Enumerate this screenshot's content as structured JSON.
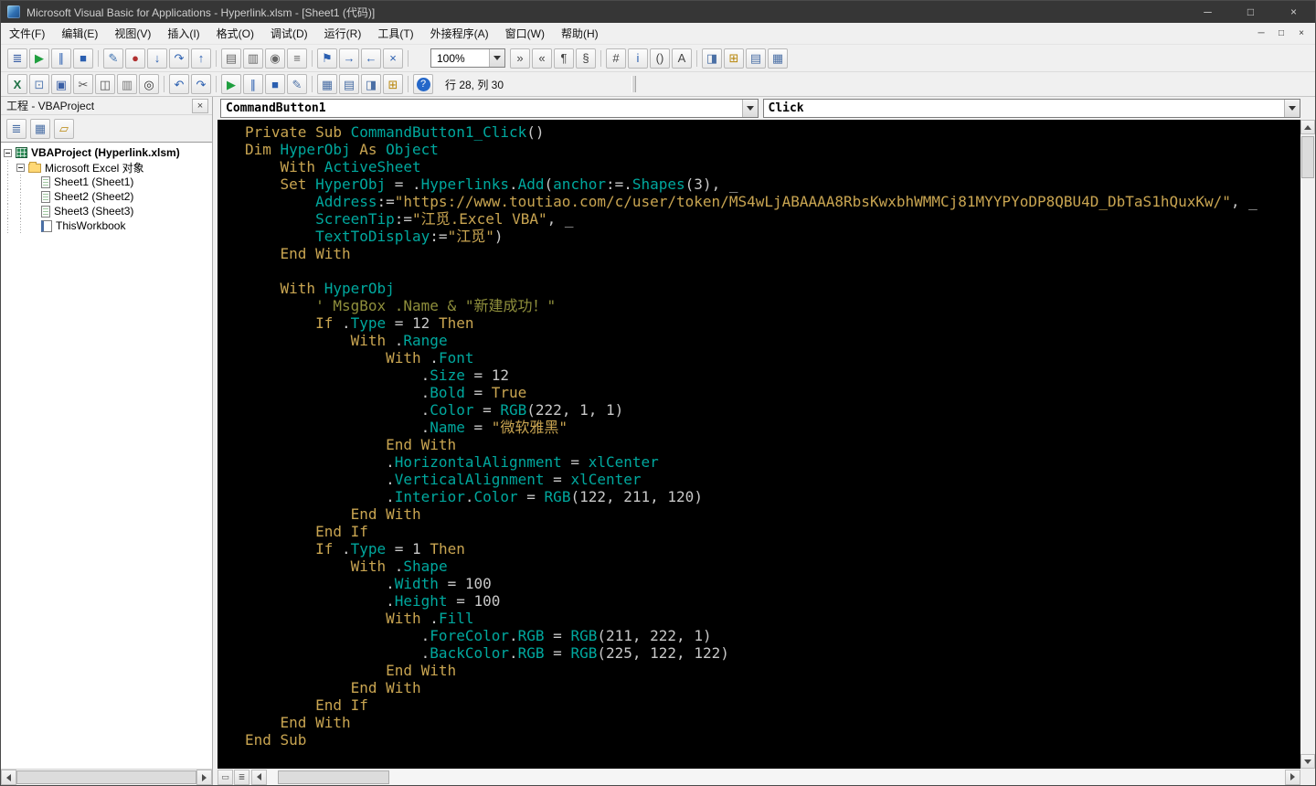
{
  "colors": {
    "keyword": "#c9a551",
    "identifier": "#00a89e",
    "string": "#c9a551",
    "normal": "#c8c8c8",
    "comment": "#8f8f3c",
    "code_bg": "#000000",
    "titlebar_bg": "#363636",
    "chrome_bg": "#f0f0f0"
  },
  "window": {
    "title": "Microsoft Visual Basic for Applications - Hyperlink.xlsm - [Sheet1 (代码)]",
    "controls": {
      "minimize": "─",
      "maximize": "□",
      "close": "×"
    }
  },
  "menu": {
    "items": [
      {
        "name": "file",
        "label": "文件(F)"
      },
      {
        "name": "edit",
        "label": "编辑(E)"
      },
      {
        "name": "view",
        "label": "视图(V)"
      },
      {
        "name": "insert",
        "label": "插入(I)"
      },
      {
        "name": "format",
        "label": "格式(O)"
      },
      {
        "name": "debug",
        "label": "调试(D)"
      },
      {
        "name": "run",
        "label": "运行(R)"
      },
      {
        "name": "tools",
        "label": "工具(T)"
      },
      {
        "name": "addins",
        "label": "外接程序(A)"
      },
      {
        "name": "window",
        "label": "窗口(W)"
      },
      {
        "name": "help",
        "label": "帮助(H)"
      }
    ],
    "child_controls": {
      "minimize": "─",
      "restore": "□",
      "close": "×"
    }
  },
  "toolbar_edit_debug": {
    "zoom_value": "100%",
    "buttons_left": [
      {
        "name": "list-properties-button",
        "glyph": "≣",
        "color": "#3a5fa5"
      },
      {
        "name": "run-sub-button",
        "glyph": "▶",
        "color": "#1e9e3e"
      },
      {
        "name": "break-button",
        "glyph": "∥",
        "color": "#2b5fb0"
      },
      {
        "name": "reset-button",
        "glyph": "■",
        "color": "#2b5fb0"
      },
      {
        "sep": true
      },
      {
        "name": "design-mode-button",
        "glyph": "✎",
        "color": "#3a6fae"
      },
      {
        "name": "toggle-breakpoint-button",
        "glyph": "●",
        "color": "#b03030"
      },
      {
        "name": "step-into-button",
        "glyph": "↓",
        "color": "#2b5fb0"
      },
      {
        "name": "step-over-button",
        "glyph": "↷",
        "color": "#2b5fb0"
      },
      {
        "name": "step-out-button",
        "glyph": "↑",
        "color": "#2b5fb0"
      },
      {
        "sep": true
      },
      {
        "name": "locals-window-button",
        "glyph": "▤",
        "color": "#666666"
      },
      {
        "name": "immediate-window-button",
        "glyph": "▥",
        "color": "#666666"
      },
      {
        "name": "watch-window-button",
        "glyph": "◉",
        "color": "#666666"
      },
      {
        "name": "call-stack-button",
        "glyph": "≡",
        "color": "#666666"
      },
      {
        "sep": true
      },
      {
        "name": "toggle-bookmark-button",
        "glyph": "⚑",
        "color": "#2b5fb0"
      },
      {
        "name": "next-bookmark-button",
        "glyph": "→",
        "color": "#2b5fb0"
      },
      {
        "name": "previous-bookmark-button",
        "glyph": "←",
        "color": "#2b5fb0"
      },
      {
        "name": "clear-bookmarks-button",
        "glyph": "×",
        "color": "#2b5fb0"
      },
      {
        "sep": true
      }
    ],
    "buttons_right": [
      {
        "name": "indent-button",
        "glyph": "»",
        "color": "#444444"
      },
      {
        "name": "outdent-button",
        "glyph": "«",
        "color": "#444444"
      },
      {
        "name": "comment-block-button",
        "glyph": "¶",
        "color": "#444444"
      },
      {
        "name": "uncomment-block-button",
        "glyph": "§",
        "color": "#444444"
      },
      {
        "sep": true
      },
      {
        "name": "list-constants-button",
        "glyph": "#",
        "color": "#444444"
      },
      {
        "name": "quick-info-button",
        "glyph": "i",
        "color": "#2b5fb0"
      },
      {
        "name": "parameter-info-button",
        "glyph": "()",
        "color": "#444444"
      },
      {
        "name": "complete-word-button",
        "glyph": "A",
        "color": "#444444"
      },
      {
        "sep": true
      },
      {
        "name": "object-browser-top-button",
        "glyph": "◨",
        "color": "#4a6fa5"
      },
      {
        "name": "toolbox-top-button",
        "glyph": "⊞",
        "color": "#b8860b"
      },
      {
        "name": "properties-top-button",
        "glyph": "▤",
        "color": "#4a6fa5"
      },
      {
        "name": "project-top-button",
        "glyph": "▦",
        "color": "#4a6fa5"
      }
    ]
  },
  "toolbar_standard": {
    "position_text": "行 28, 列 30",
    "buttons": [
      {
        "name": "view-excel-button",
        "glyph": "X",
        "color": "#1e7145"
      },
      {
        "name": "insert-userform-button",
        "glyph": "⊡",
        "color": "#5b7fb4"
      },
      {
        "name": "save-button",
        "glyph": "▣",
        "color": "#3a5fa5"
      },
      {
        "name": "cut-button",
        "glyph": "✂",
        "color": "#555555"
      },
      {
        "name": "copy-button",
        "glyph": "◫",
        "color": "#555555"
      },
      {
        "name": "paste-button",
        "glyph": "▥",
        "color": "#777777"
      },
      {
        "name": "find-button",
        "glyph": "◎",
        "color": "#333333"
      },
      {
        "sep": true
      },
      {
        "name": "undo-button",
        "glyph": "↶",
        "color": "#2b5fb0"
      },
      {
        "name": "redo-button",
        "glyph": "↷",
        "color": "#2b5fb0"
      },
      {
        "sep": true
      },
      {
        "name": "run-button",
        "glyph": "▶",
        "color": "#1e9e3e"
      },
      {
        "name": "break-std-button",
        "glyph": "∥",
        "color": "#2b5fb0"
      },
      {
        "name": "reset-std-button",
        "glyph": "■",
        "color": "#2b5fb0"
      },
      {
        "name": "design-mode-std-button",
        "glyph": "✎",
        "color": "#4a6fa5"
      },
      {
        "sep": true
      },
      {
        "name": "project-explorer-button",
        "glyph": "▦",
        "color": "#4a6fa5"
      },
      {
        "name": "properties-window-button",
        "glyph": "▤",
        "color": "#4a6fa5"
      },
      {
        "name": "object-browser-button",
        "glyph": "◨",
        "color": "#4a6fa5"
      },
      {
        "name": "toolbox-button",
        "glyph": "⊞",
        "color": "#b8860b"
      },
      {
        "sep": true
      },
      {
        "name": "help-button",
        "glyph": "?",
        "color": "#ffffff"
      }
    ]
  },
  "project_panel": {
    "title": "工程 - VBAProject",
    "close_glyph": "×",
    "toolbar": [
      {
        "name": "view-code-button",
        "glyph": "≣",
        "color": "#4a6fa5"
      },
      {
        "name": "view-object-button",
        "glyph": "▦",
        "color": "#4a6fa5"
      },
      {
        "name": "toggle-folders-button",
        "glyph": "▱",
        "color": "#b8860b"
      }
    ],
    "tree": [
      {
        "id": "vbaproject",
        "level": 0,
        "expander": true,
        "icon": "excel-project",
        "label": "VBAProject (Hyperlink.xlsm)",
        "bold": true
      },
      {
        "id": "excel-objects",
        "level": 1,
        "expander": true,
        "icon": "folder",
        "label": "Microsoft Excel 对象",
        "bold": false
      },
      {
        "id": "sheet1",
        "level": 2,
        "expander": false,
        "icon": "worksheet",
        "label": "Sheet1 (Sheet1)",
        "bold": false
      },
      {
        "id": "sheet2",
        "level": 2,
        "expander": false,
        "icon": "worksheet",
        "label": "Sheet2 (Sheet2)",
        "bold": false
      },
      {
        "id": "sheet3",
        "level": 2,
        "expander": false,
        "icon": "worksheet",
        "label": "Sheet3 (Sheet3)",
        "bold": false
      },
      {
        "id": "thisworkbook",
        "level": 2,
        "expander": false,
        "icon": "workbook",
        "label": "ThisWorkbook",
        "bold": false
      }
    ]
  },
  "code_window": {
    "object_combo": "CommandButton1",
    "procedure_combo": "Click",
    "view_buttons": [
      {
        "name": "procedure-view-button",
        "glyph": "▭"
      },
      {
        "name": "full-module-view-button",
        "glyph": "≣"
      }
    ],
    "lines": [
      [
        [
          "k",
          "Private Sub "
        ],
        [
          "i",
          "CommandButton1_Click"
        ],
        [
          "n",
          "()"
        ]
      ],
      [
        [
          "k",
          "Dim "
        ],
        [
          "i",
          "HyperObj"
        ],
        [
          "k",
          " As "
        ],
        [
          "i",
          "Object"
        ]
      ],
      [
        [
          "n",
          "    "
        ],
        [
          "k",
          "With "
        ],
        [
          "i",
          "ActiveSheet"
        ]
      ],
      [
        [
          "n",
          "    "
        ],
        [
          "k",
          "Set "
        ],
        [
          "i",
          "HyperObj"
        ],
        [
          "n",
          " = ."
        ],
        [
          "i",
          "Hyperlinks"
        ],
        [
          "n",
          "."
        ],
        [
          "i",
          "Add"
        ],
        [
          "n",
          "("
        ],
        [
          "i",
          "anchor"
        ],
        [
          "n",
          ":=."
        ],
        [
          "i",
          "Shapes"
        ],
        [
          "n",
          "(3), _"
        ]
      ],
      [
        [
          "n",
          "        "
        ],
        [
          "i",
          "Address"
        ],
        [
          "n",
          ":="
        ],
        [
          "s",
          "\"https://www.toutiao.com/c/user/token/MS4wLjABAAAA8RbsKwxbhWMMCj81MYYPYoDP8QBU4D_DbTaS1hQuxKw/\""
        ],
        [
          "n",
          ", _"
        ]
      ],
      [
        [
          "n",
          "        "
        ],
        [
          "i",
          "ScreenTip"
        ],
        [
          "n",
          ":="
        ],
        [
          "s",
          "\"江觅.Excel VBA\""
        ],
        [
          "n",
          ", _"
        ]
      ],
      [
        [
          "n",
          "        "
        ],
        [
          "i",
          "TextToDisplay"
        ],
        [
          "n",
          ":="
        ],
        [
          "s",
          "\"江觅\""
        ],
        [
          "n",
          ")"
        ]
      ],
      [
        [
          "n",
          "    "
        ],
        [
          "k",
          "End With"
        ]
      ],
      [],
      [
        [
          "n",
          "    "
        ],
        [
          "k",
          "With "
        ],
        [
          "i",
          "HyperObj"
        ]
      ],
      [
        [
          "n",
          "        "
        ],
        [
          "c",
          "' MsgBox .Name & \"新建成功！\""
        ]
      ],
      [
        [
          "n",
          "        "
        ],
        [
          "k",
          "If "
        ],
        [
          "n",
          "."
        ],
        [
          "i",
          "Type"
        ],
        [
          "n",
          " = 12 "
        ],
        [
          "k",
          "Then"
        ]
      ],
      [
        [
          "n",
          "            "
        ],
        [
          "k",
          "With "
        ],
        [
          "n",
          "."
        ],
        [
          "i",
          "Range"
        ]
      ],
      [
        [
          "n",
          "                "
        ],
        [
          "k",
          "With "
        ],
        [
          "n",
          "."
        ],
        [
          "i",
          "Font"
        ]
      ],
      [
        [
          "n",
          "                    ."
        ],
        [
          "i",
          "Size"
        ],
        [
          "n",
          " = 12"
        ]
      ],
      [
        [
          "n",
          "                    ."
        ],
        [
          "i",
          "Bold"
        ],
        [
          "n",
          " = "
        ],
        [
          "k",
          "True"
        ]
      ],
      [
        [
          "n",
          "                    ."
        ],
        [
          "i",
          "Color"
        ],
        [
          "n",
          " = "
        ],
        [
          "i",
          "RGB"
        ],
        [
          "n",
          "(222, 1, 1)"
        ]
      ],
      [
        [
          "n",
          "                    ."
        ],
        [
          "i",
          "Name"
        ],
        [
          "n",
          " = "
        ],
        [
          "s",
          "\"微软雅黑\""
        ]
      ],
      [
        [
          "n",
          "                "
        ],
        [
          "k",
          "End With"
        ]
      ],
      [
        [
          "n",
          "                ."
        ],
        [
          "i",
          "HorizontalAlignment"
        ],
        [
          "n",
          " = "
        ],
        [
          "i",
          "xlCenter"
        ]
      ],
      [
        [
          "n",
          "                ."
        ],
        [
          "i",
          "VerticalAlignment"
        ],
        [
          "n",
          " = "
        ],
        [
          "i",
          "xlCenter"
        ]
      ],
      [
        [
          "n",
          "                ."
        ],
        [
          "i",
          "Interior"
        ],
        [
          "n",
          "."
        ],
        [
          "i",
          "Color"
        ],
        [
          "n",
          " = "
        ],
        [
          "i",
          "RGB"
        ],
        [
          "n",
          "(122, 211, 120)"
        ]
      ],
      [
        [
          "n",
          "            "
        ],
        [
          "k",
          "End With"
        ]
      ],
      [
        [
          "n",
          "        "
        ],
        [
          "k",
          "End If"
        ]
      ],
      [
        [
          "n",
          "        "
        ],
        [
          "k",
          "If "
        ],
        [
          "n",
          "."
        ],
        [
          "i",
          "Type"
        ],
        [
          "n",
          " = 1 "
        ],
        [
          "k",
          "Then"
        ]
      ],
      [
        [
          "n",
          "            "
        ],
        [
          "k",
          "With "
        ],
        [
          "n",
          "."
        ],
        [
          "i",
          "Shape"
        ]
      ],
      [
        [
          "n",
          "                ."
        ],
        [
          "i",
          "Width"
        ],
        [
          "n",
          " = 100"
        ]
      ],
      [
        [
          "n",
          "                ."
        ],
        [
          "i",
          "Height"
        ],
        [
          "n",
          " = 100"
        ]
      ],
      [
        [
          "n",
          "                "
        ],
        [
          "k",
          "With "
        ],
        [
          "n",
          "."
        ],
        [
          "i",
          "Fill"
        ]
      ],
      [
        [
          "n",
          "                    ."
        ],
        [
          "i",
          "ForeColor"
        ],
        [
          "n",
          "."
        ],
        [
          "i",
          "RGB"
        ],
        [
          "n",
          " = "
        ],
        [
          "i",
          "RGB"
        ],
        [
          "n",
          "(211, 222, 1)"
        ]
      ],
      [
        [
          "n",
          "                    ."
        ],
        [
          "i",
          "BackColor"
        ],
        [
          "n",
          "."
        ],
        [
          "i",
          "RGB"
        ],
        [
          "n",
          " = "
        ],
        [
          "i",
          "RGB"
        ],
        [
          "n",
          "(225, 122, 122)"
        ]
      ],
      [
        [
          "n",
          "                "
        ],
        [
          "k",
          "End With"
        ]
      ],
      [
        [
          "n",
          "            "
        ],
        [
          "k",
          "End With"
        ]
      ],
      [
        [
          "n",
          "        "
        ],
        [
          "k",
          "End If"
        ]
      ],
      [
        [
          "n",
          "    "
        ],
        [
          "k",
          "End With"
        ]
      ],
      [
        [
          "k",
          "End Sub"
        ]
      ]
    ]
  }
}
